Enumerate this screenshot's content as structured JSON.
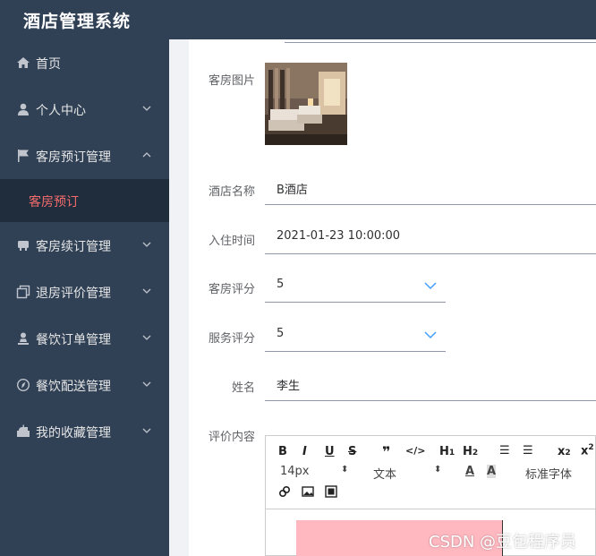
{
  "app": {
    "title": "酒店管理系统"
  },
  "sidebar": {
    "items": [
      {
        "label": "首页",
        "icon": "home-icon"
      },
      {
        "label": "个人中心",
        "icon": "user-icon"
      },
      {
        "label": "客房预订管理",
        "icon": "flag-icon"
      },
      {
        "label": "客房续订管理",
        "icon": "bed-icon"
      },
      {
        "label": "退房评价管理",
        "icon": "copy-icon"
      },
      {
        "label": "餐饮订单管理",
        "icon": "person-stand-icon"
      },
      {
        "label": "餐饮配送管理",
        "icon": "compass-icon"
      },
      {
        "label": "我的收藏管理",
        "icon": "mailbox-icon"
      }
    ],
    "subitem": {
      "label": "客房预订",
      "color": "#f56c6c"
    }
  },
  "form": {
    "room_image_label": "客房图片",
    "hotel_name_label": "酒店名称",
    "hotel_name_value": "B酒店",
    "checkin_label": "入住时间",
    "checkin_value": "2021-01-23 10:00:00",
    "room_rating_label": "客房评分",
    "room_rating_value": "5",
    "service_rating_label": "服务评分",
    "service_rating_value": "5",
    "name_label": "姓名",
    "name_value": "李生",
    "review_label": "评价内容"
  },
  "editor": {
    "font_size": "14px",
    "text_type": "文本",
    "font_family": "标准字体"
  },
  "watermark": "CSDN @豆包程序员",
  "colors": {
    "sidebar_bg": "#304156",
    "accent": "#f56c6c",
    "chevron": "#409eff"
  }
}
